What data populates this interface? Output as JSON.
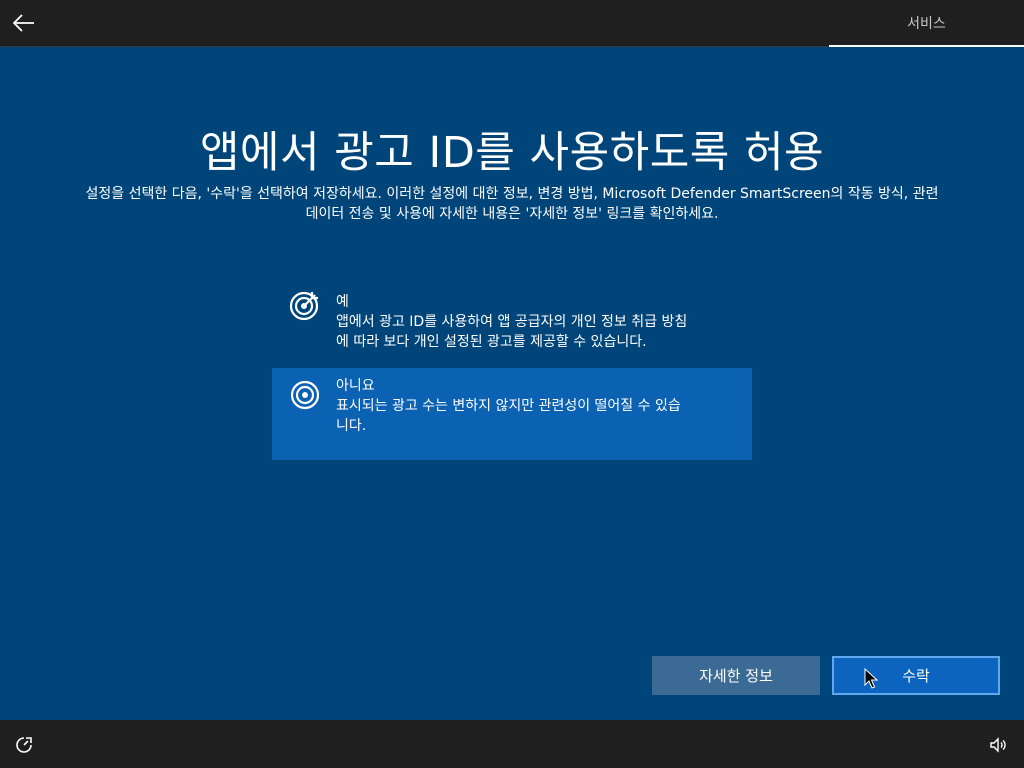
{
  "header": {
    "back_icon": "back-arrow-icon",
    "tab_label": "서비스"
  },
  "main": {
    "title": "앱에서 광고 ID를 사용하도록 허용",
    "description_line1": "설정을 선택한 다음, '수락'을 선택하여 저장하세요. 이러한 설정에 대한 정보, 변경 방법, Microsoft Defender SmartScreen의 작동 방식, 관련",
    "description_line2": "데이터 전송 및 사용에 자세한 내용은 '자세한 정보' 링크를 확인하세요."
  },
  "options": [
    {
      "title": "예",
      "desc_line1": "앱에서 광고 ID를 사용하여 앱 공급자의 개인 정보 취급 방침",
      "desc_line2": "에 따라 보다 개인 설정된 광고를 제공할 수 있습니다.",
      "icon": "target-arrow-icon",
      "selected": false
    },
    {
      "title": "아니요",
      "desc_line1": "표시되는 광고 수는 변하지 않지만 관련성이 떨어질 수 있습",
      "desc_line2": "니다.",
      "icon": "target-icon",
      "selected": true
    }
  ],
  "buttons": {
    "learn_more": "자세한 정보",
    "accept": "수락"
  },
  "footer": {
    "ease_of_access_icon": "ease-of-access-icon",
    "volume_icon": "volume-icon"
  },
  "colors": {
    "background": "#00457a",
    "selected_option": "#0b62b3",
    "accept_button": "#0d64be",
    "learn_button": "#3b6a94",
    "bars": "#1f1f1f"
  }
}
